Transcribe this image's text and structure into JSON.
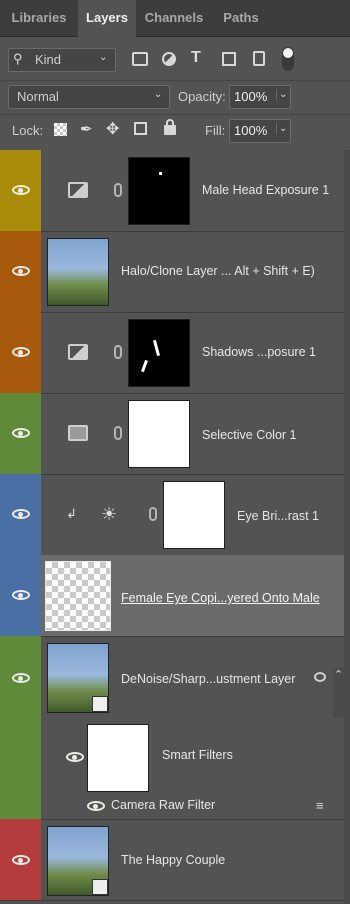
{
  "tabs": [
    {
      "label": "Libraries",
      "active": false
    },
    {
      "label": "Layers",
      "active": true
    },
    {
      "label": "Channels",
      "active": false
    },
    {
      "label": "Paths",
      "active": false
    }
  ],
  "filter": {
    "kind_label": "Kind"
  },
  "blend": {
    "mode": "Normal",
    "opacity_label": "Opacity:",
    "opacity_value": "100%"
  },
  "lock": {
    "label": "Lock:",
    "fill_label": "Fill:",
    "fill_value": "100%"
  },
  "layers": [
    {
      "name": "Male Head Exposure 1",
      "color": "#a88c0a"
    },
    {
      "name": "Halo/Clone Layer ... Alt + Shift + E)",
      "color": "#a85a0c"
    },
    {
      "name": "Shadows ...posure 1",
      "color": "#a85a0c"
    },
    {
      "name": "Selective Color 1",
      "color": "#5e8a3a"
    },
    {
      "name": "Eye Bri...rast 1",
      "color": "#4a6fa5"
    },
    {
      "name": "Female Eye Copi...yered Onto Male",
      "color": "#4a6fa5"
    },
    {
      "name": "DeNoise/Sharp...ustment Layer",
      "color": "#5e8a3a"
    },
    {
      "name": "The Happy Couple",
      "color": "#b43c3c"
    }
  ],
  "smart": {
    "filters_label": "Smart Filters",
    "camera_raw_label": "Camera Raw Filter"
  }
}
